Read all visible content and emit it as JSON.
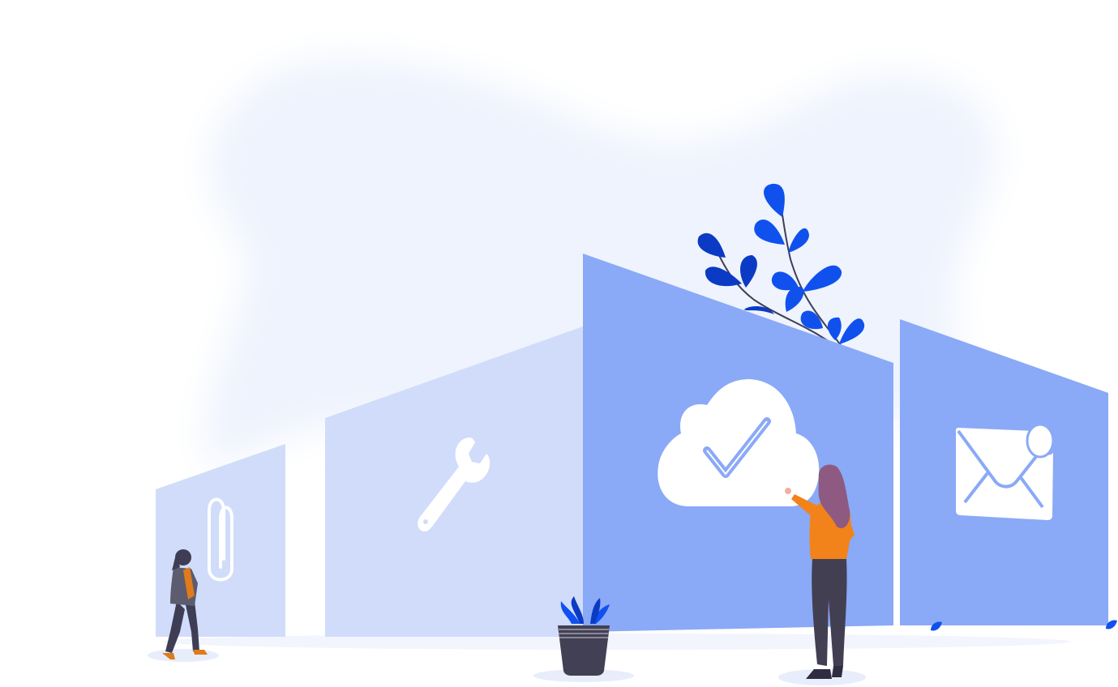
{
  "illustration": {
    "panels": [
      {
        "name": "paperclip-panel",
        "icon": "paperclip-icon",
        "tone": "light"
      },
      {
        "name": "wrench-panel",
        "icon": "wrench-icon",
        "tone": "light"
      },
      {
        "name": "cloud-panel",
        "icon": "cloud-check-icon",
        "tone": "medium"
      },
      {
        "name": "mail-panel",
        "icon": "mail-icon",
        "tone": "medium"
      }
    ],
    "figures": [
      "woman-walking",
      "woman-pointing"
    ],
    "decor": [
      "branch-leaves",
      "potted-plant",
      "blob-background"
    ]
  },
  "colors": {
    "background_blob": "#eef3fd",
    "panel_light": "#d0dcfa",
    "panel_medium": "#8aa9f7",
    "icon_white": "#ffffff",
    "leaf_blue": "#1051ee",
    "leaf_dark": "#0b3bc4",
    "pot": "#424054",
    "shirt_orange": "#f2821a",
    "pants_dark": "#433f52",
    "hair_purple": "#8e5a82",
    "shadow": "#e8edfb"
  }
}
